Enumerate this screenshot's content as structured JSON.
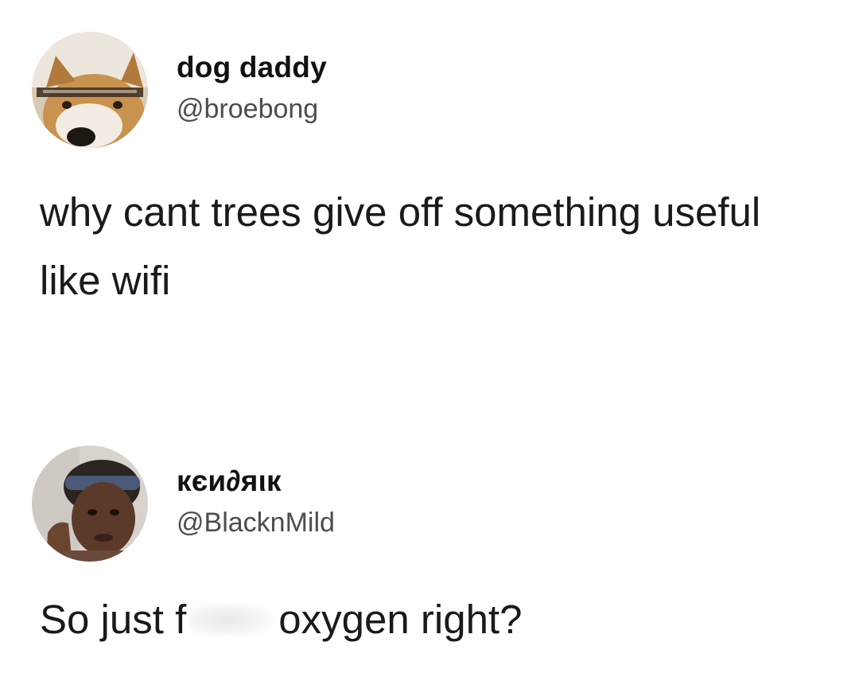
{
  "tweets": [
    {
      "author": {
        "display_name": "dog daddy",
        "handle": "@broebong",
        "avatar_icon": "dog-avatar-icon"
      },
      "text": "why cant trees give off something useful like wifi"
    },
    {
      "author": {
        "display_name": "кєи∂яιк",
        "handle": "@BlacknMild",
        "avatar_icon": "person-avatar-icon"
      },
      "text_before_censor": "So just f",
      "text_after_censor": "oxygen right?"
    }
  ],
  "colors": {
    "background": "#ffffff",
    "text": "#1a1a1a",
    "handle": "#4d4d4d"
  }
}
